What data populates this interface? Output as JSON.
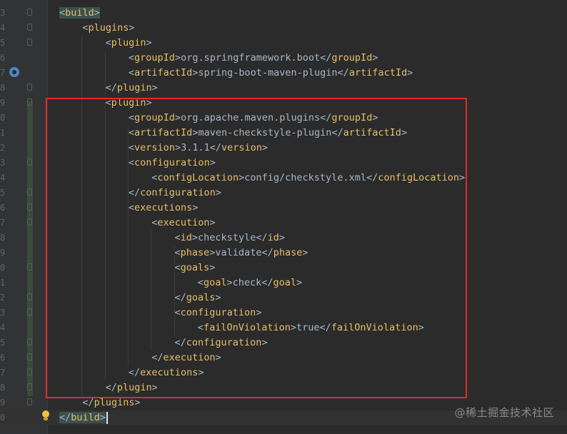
{
  "gutter": {
    "line_numbers": [
      "3",
      "4",
      "5",
      "6",
      "7",
      "8",
      "9",
      "0",
      "1",
      "2",
      "3",
      "4",
      "5",
      "6",
      "7",
      "8",
      "9",
      "0",
      "1",
      "2",
      "3",
      "4",
      "5",
      "6",
      "7",
      "8",
      "9",
      "0"
    ]
  },
  "code_lines": [
    {
      "open": "<",
      "name": "build",
      "close": ">",
      "content": "",
      "end_open": "",
      "end_name": "",
      "end_close": ""
    },
    {
      "open": "<",
      "name": "plugins",
      "close": ">",
      "content": "",
      "end_open": "",
      "end_name": "",
      "end_close": ""
    },
    {
      "open": "<",
      "name": "plugin",
      "close": ">",
      "content": "",
      "end_open": "",
      "end_name": "",
      "end_close": ""
    },
    {
      "open": "<",
      "name": "groupId",
      "close": ">",
      "content": "org.springframework.boot",
      "end_open": "</",
      "end_name": "groupId",
      "end_close": ">"
    },
    {
      "open": "<",
      "name": "artifactId",
      "close": ">",
      "content": "spring-boot-maven-plugin",
      "end_open": "</",
      "end_name": "artifactId",
      "end_close": ">"
    },
    {
      "open": "</",
      "name": "plugin",
      "close": ">",
      "content": "",
      "end_open": "",
      "end_name": "",
      "end_close": ""
    },
    {
      "open": "<",
      "name": "plugin",
      "close": ">",
      "content": "",
      "end_open": "",
      "end_name": "",
      "end_close": ""
    },
    {
      "open": "<",
      "name": "groupId",
      "close": ">",
      "content": "org.apache.maven.plugins",
      "end_open": "</",
      "end_name": "groupId",
      "end_close": ">"
    },
    {
      "open": "<",
      "name": "artifactId",
      "close": ">",
      "content": "maven-checkstyle-plugin",
      "end_open": "</",
      "end_name": "artifactId",
      "end_close": ">"
    },
    {
      "open": "<",
      "name": "version",
      "close": ">",
      "content": "3.1.1",
      "end_open": "</",
      "end_name": "version",
      "end_close": ">"
    },
    {
      "open": "<",
      "name": "configuration",
      "close": ">",
      "content": "",
      "end_open": "",
      "end_name": "",
      "end_close": ""
    },
    {
      "open": "<",
      "name": "configLocation",
      "close": ">",
      "content": "config/checkstyle.xml",
      "end_open": "</",
      "end_name": "configLocation",
      "end_close": ">"
    },
    {
      "open": "</",
      "name": "configuration",
      "close": ">",
      "content": "",
      "end_open": "",
      "end_name": "",
      "end_close": ""
    },
    {
      "open": "<",
      "name": "executions",
      "close": ">",
      "content": "",
      "end_open": "",
      "end_name": "",
      "end_close": ""
    },
    {
      "open": "<",
      "name": "execution",
      "close": ">",
      "content": "",
      "end_open": "",
      "end_name": "",
      "end_close": ""
    },
    {
      "open": "<",
      "name": "id",
      "close": ">",
      "content": "checkstyle",
      "end_open": "</",
      "end_name": "id",
      "end_close": ">"
    },
    {
      "open": "<",
      "name": "phase",
      "close": ">",
      "content": "validate",
      "end_open": "</",
      "end_name": "phase",
      "end_close": ">"
    },
    {
      "open": "<",
      "name": "goals",
      "close": ">",
      "content": "",
      "end_open": "",
      "end_name": "",
      "end_close": ""
    },
    {
      "open": "<",
      "name": "goal",
      "close": ">",
      "content": "check",
      "end_open": "</",
      "end_name": "goal",
      "end_close": ">"
    },
    {
      "open": "</",
      "name": "goals",
      "close": ">",
      "content": "",
      "end_open": "",
      "end_name": "",
      "end_close": ""
    },
    {
      "open": "<",
      "name": "configuration",
      "close": ">",
      "content": "",
      "end_open": "",
      "end_name": "",
      "end_close": ""
    },
    {
      "open": "<",
      "name": "failOnViolation",
      "close": ">",
      "content": "true",
      "end_open": "</",
      "end_name": "failOnViolation",
      "end_close": ">"
    },
    {
      "open": "</",
      "name": "configuration",
      "close": ">",
      "content": "",
      "end_open": "",
      "end_name": "",
      "end_close": ""
    },
    {
      "open": "</",
      "name": "execution",
      "close": ">",
      "content": "",
      "end_open": "",
      "end_name": "",
      "end_close": ""
    },
    {
      "open": "</",
      "name": "executions",
      "close": ">",
      "content": "",
      "end_open": "",
      "end_name": "",
      "end_close": ""
    },
    {
      "open": "</",
      "name": "plugin",
      "close": ">",
      "content": "",
      "end_open": "",
      "end_name": "",
      "end_close": ""
    },
    {
      "open": "</",
      "name": "plugins",
      "close": ">",
      "content": "",
      "end_open": "",
      "end_name": "",
      "end_close": ""
    },
    {
      "open": "</",
      "name": "build",
      "close": ">",
      "content": "",
      "end_open": "",
      "end_name": "",
      "end_close": ""
    }
  ],
  "watermark": "@稀土掘金技术社区",
  "colors": {
    "background": "#2b2b2b",
    "tag": "#e8bf6a",
    "text": "#a9b7c6",
    "highlight_box": "#e3292a"
  },
  "icons": {
    "run_gutter": "maven-run-icon",
    "intention": "lightbulb-icon"
  }
}
